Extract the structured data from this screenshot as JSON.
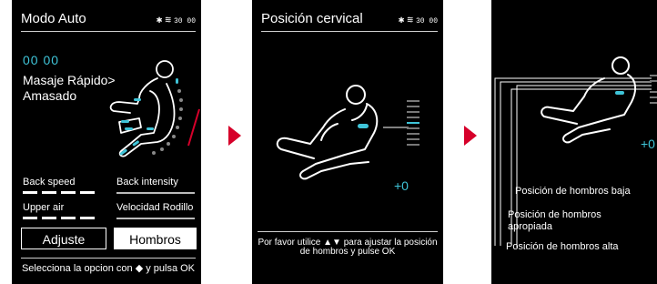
{
  "panel1": {
    "title": "Modo Auto",
    "status": "30 00",
    "timer": "00 00",
    "program": "Masaje Rápido> Amasado",
    "back_speed": "Back speed",
    "back_intensity": "Back intensity",
    "upper_air": "Upper air",
    "roller_speed": "Velocidad Rodillo",
    "adjust": "Adjuste",
    "shoulders": "Hombros",
    "hint": "Selecciona la opcion con ◆ y pulsa OK"
  },
  "panel2": {
    "title": "Posición cervical",
    "status": "30 00",
    "offset": "+0",
    "hint": "Por favor utilice ▲▼ para ajustar la posición de hombros y pulse OK"
  },
  "panel3": {
    "offset": "+0",
    "pos_low": "Posición de hombros baja",
    "pos_ok": "Posición de hombros apropiada",
    "pos_high": "Posición de hombros alta"
  },
  "colors": {
    "accent": "#3fc4d8",
    "arrow": "#d6002a",
    "bg": "#000000"
  },
  "icons": {
    "bluetooth": "bluetooth-icon",
    "heat": "heat-icon"
  }
}
